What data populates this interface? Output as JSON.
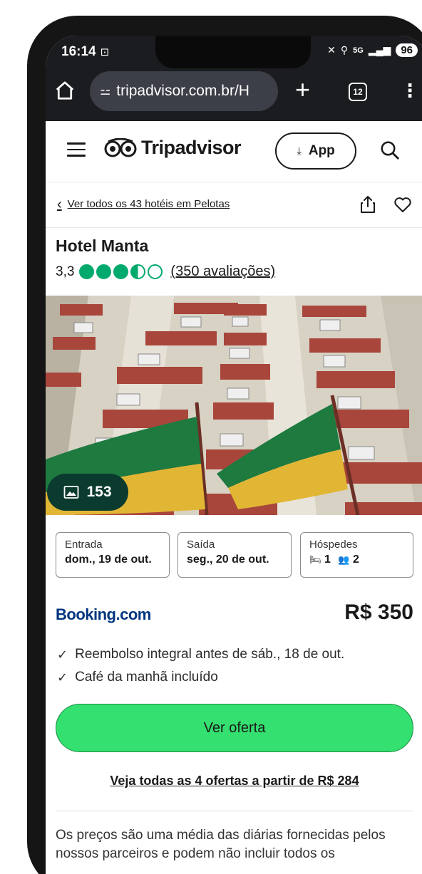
{
  "status_bar": {
    "time": "16:14",
    "network": "5G",
    "battery": "96"
  },
  "browser": {
    "url": "tripadvisor.com.br/H",
    "tab_count": "12",
    "new_tab_symbol": "+",
    "menu_symbol": "⋮"
  },
  "header": {
    "logo": "Tripadvisor",
    "app_button": "App"
  },
  "breadcrumb": {
    "back_label": "Ver todos os 43 hotéis em Pelotas"
  },
  "hotel": {
    "name": "Hotel Manta",
    "rating": "3,3",
    "rating_bubbles": 3.5,
    "reviews_link": "(350 avaliações)",
    "photo_count": "153"
  },
  "booking": {
    "checkin_label": "Entrada",
    "checkin_value": "dom., 19 de out.",
    "checkout_label": "Saída",
    "checkout_value": "seg., 20 de out.",
    "guests_label": "Hóspedes",
    "rooms": "1",
    "guests": "2"
  },
  "offer": {
    "provider": "Booking.com",
    "price": "R$ 350",
    "perks": [
      "Reembolso integral antes de sáb., 18 de out.",
      "Café da manhã incluído"
    ],
    "cta": "Ver oferta",
    "all_offers_link": "Veja todas as 4 ofertas a partir de R$ 284"
  },
  "disclaimer": "Os preços são uma média das diárias fornecidas pelos nossos parceiros e podem não incluir todos os",
  "colors": {
    "brand_green": "#00aa6c",
    "cta_green": "#34e06f",
    "booking_blue": "#003580",
    "photo_badge": "#0b3b2e"
  },
  "icons": [
    "home-icon",
    "tune-icon",
    "hamburger-icon",
    "owl-logo-icon",
    "download-icon",
    "search-icon",
    "chevron-left-icon",
    "share-icon",
    "heart-icon",
    "image-icon",
    "bed-icon",
    "people-icon",
    "check-icon"
  ]
}
